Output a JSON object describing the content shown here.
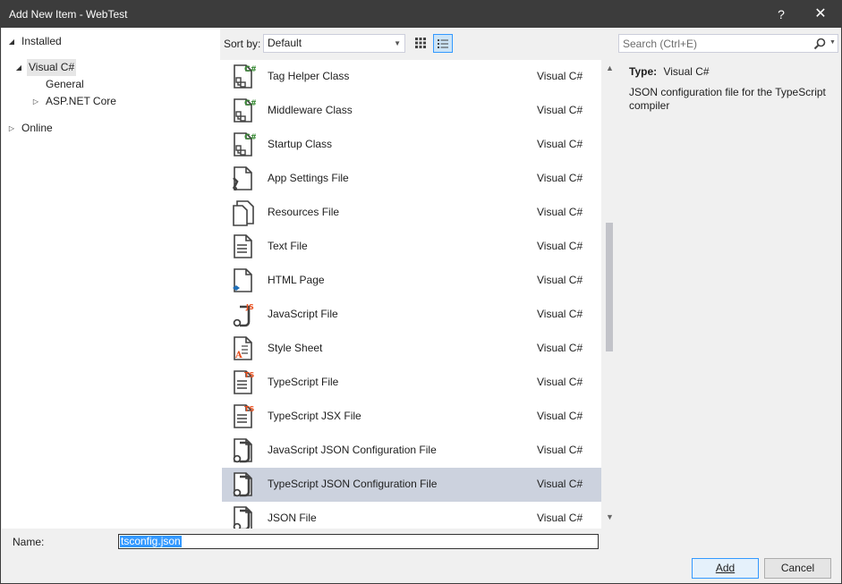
{
  "window": {
    "title": "Add New Item - WebTest",
    "help_label": "?",
    "close_label": "✕"
  },
  "tree": {
    "installed": "Installed",
    "visual_csharp": "Visual C#",
    "general": "General",
    "aspnet_core": "ASP.NET Core",
    "online": "Online"
  },
  "toolbar": {
    "sort_label": "Sort by:",
    "sort_value": "Default"
  },
  "items": [
    {
      "name": "Tag Helper Class",
      "lang": "Visual C#",
      "icon": "csharp-class-icon"
    },
    {
      "name": "Middleware Class",
      "lang": "Visual C#",
      "icon": "csharp-class-icon"
    },
    {
      "name": "Startup Class",
      "lang": "Visual C#",
      "icon": "csharp-class-icon"
    },
    {
      "name": "App Settings File",
      "lang": "Visual C#",
      "icon": "settings-file-icon"
    },
    {
      "name": "Resources File",
      "lang": "Visual C#",
      "icon": "resources-file-icon"
    },
    {
      "name": "Text File",
      "lang": "Visual C#",
      "icon": "text-file-icon"
    },
    {
      "name": "HTML Page",
      "lang": "Visual C#",
      "icon": "html-page-icon"
    },
    {
      "name": "JavaScript File",
      "lang": "Visual C#",
      "icon": "javascript-file-icon"
    },
    {
      "name": "Style Sheet",
      "lang": "Visual C#",
      "icon": "style-sheet-icon"
    },
    {
      "name": "TypeScript File",
      "lang": "Visual C#",
      "icon": "typescript-file-icon"
    },
    {
      "name": "TypeScript JSX File",
      "lang": "Visual C#",
      "icon": "typescript-jsx-file-icon"
    },
    {
      "name": "JavaScript JSON Configuration File",
      "lang": "Visual C#",
      "icon": "json-config-icon"
    },
    {
      "name": "TypeScript JSON Configuration File",
      "lang": "Visual C#",
      "icon": "json-config-icon",
      "selected": true
    },
    {
      "name": "JSON File",
      "lang": "Visual C#",
      "icon": "json-file-icon"
    }
  ],
  "details": {
    "search_placeholder": "Search (Ctrl+E)",
    "type_label": "Type:",
    "type_value": "Visual C#",
    "description": "JSON configuration file for the TypeScript compiler"
  },
  "bottom": {
    "name_label": "Name:",
    "name_value": "tsconfig.json",
    "add_label": "Add",
    "cancel_label": "Cancel"
  },
  "colors": {
    "titlebar": "#3c3c3c",
    "selection": "#ccd2de",
    "accent": "#3399ff",
    "csharp_green": "#388a34",
    "js_ts_orange": "#e8501f"
  }
}
